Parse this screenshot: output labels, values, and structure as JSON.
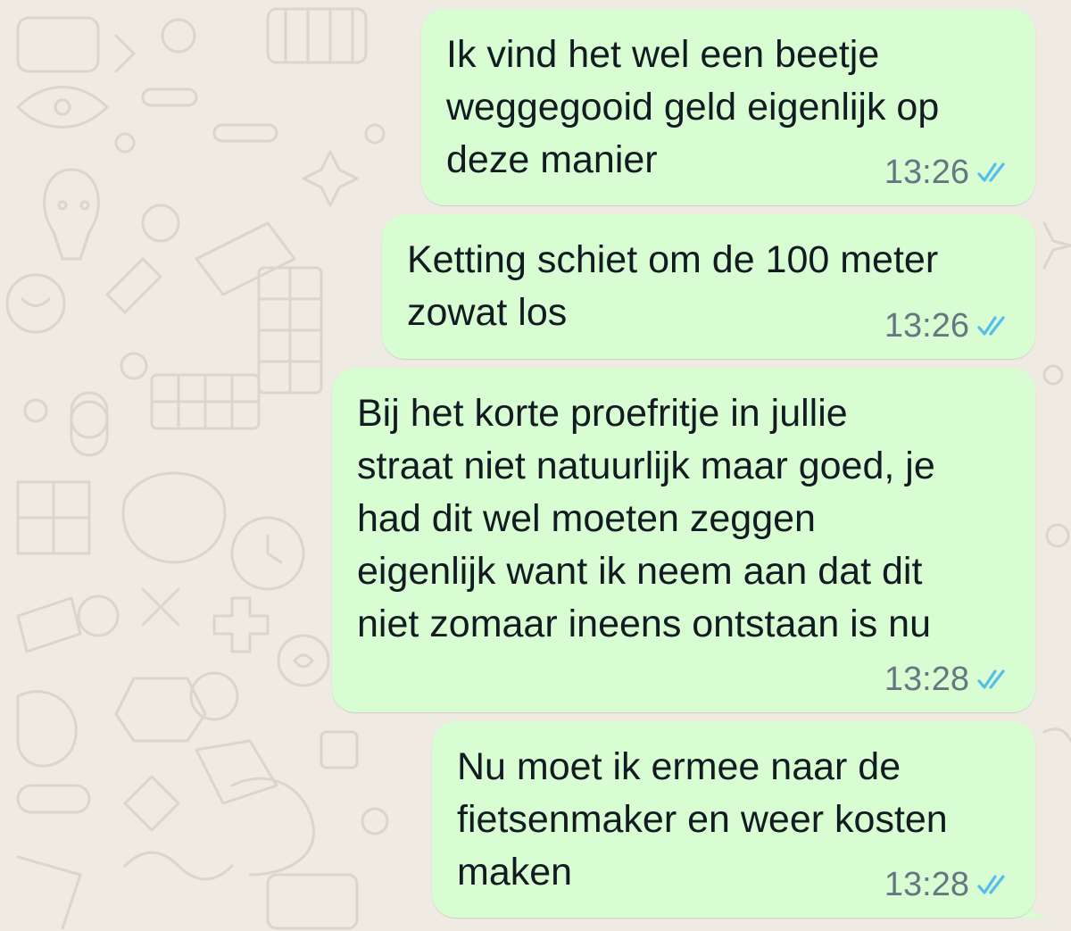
{
  "theme": {
    "background": "#efeae2",
    "bubble_outgoing": "#d9fdd3",
    "read_tick_color": "#53bdeb",
    "meta_color": "#667781"
  },
  "messages": [
    {
      "text": "Ik vind het wel een beetje\nweggegooid geld eigenlijk op\ndeze manier",
      "time": "13:26",
      "status_icon": "double-check-read-icon"
    },
    {
      "text": "Ketting schiet om de 100 meter\nzowat los",
      "time": "13:26",
      "status_icon": "double-check-read-icon"
    },
    {
      "text": "Bij het korte proefritje in jullie\nstraat niet natuurlijk maar goed, je\nhad dit wel moeten zeggen\neigenlijk want ik neem aan dat dit\nniet zomaar ineens ontstaan is nu",
      "time": "13:28",
      "status_icon": "double-check-read-icon"
    },
    {
      "text": "Nu moet ik ermee naar de\nfietsenmaker en weer kosten\nmaken",
      "time": "13:28",
      "status_icon": "double-check-read-icon"
    }
  ]
}
